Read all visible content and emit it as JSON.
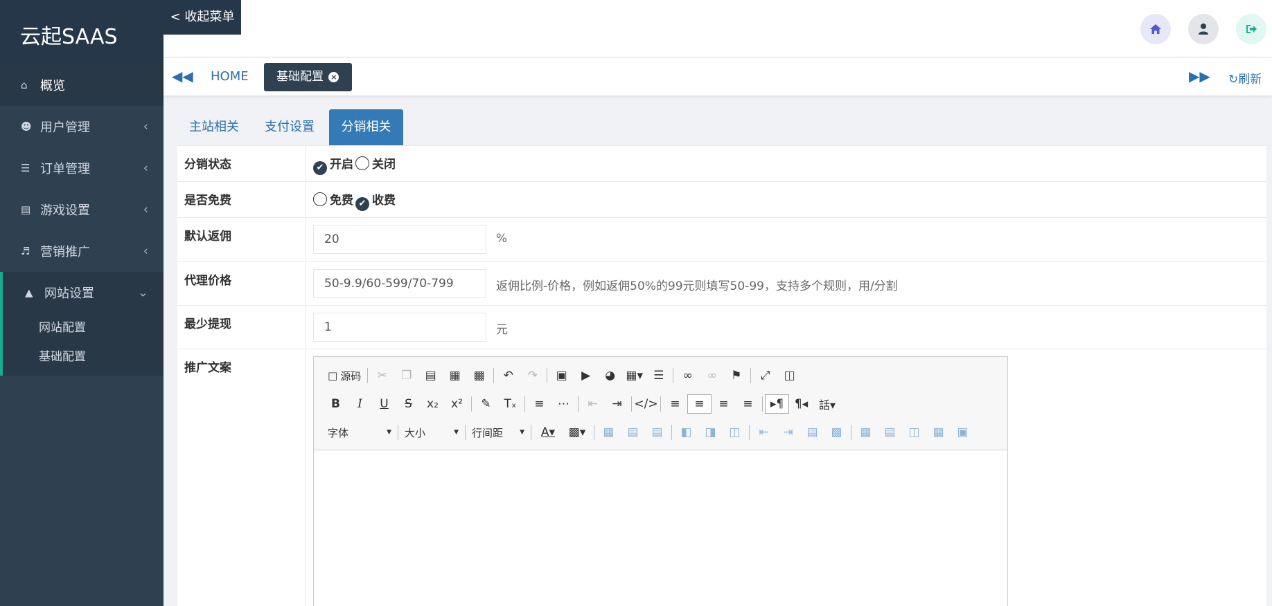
{
  "brand": "云起SAAS",
  "sidebar": {
    "items": [
      {
        "label": "概览"
      },
      {
        "label": "用户管理"
      },
      {
        "label": "订单管理"
      },
      {
        "label": "游戏设置"
      },
      {
        "label": "营销推广"
      },
      {
        "label": "网站设置"
      }
    ],
    "sub_items": [
      {
        "label": "网站配置"
      },
      {
        "label": "基础配置"
      }
    ]
  },
  "topbar": {
    "collapse_label": "< 收起菜单"
  },
  "tabbar": {
    "home_label": "HOME",
    "active_tab": "基础配置",
    "refresh_label": "刷新"
  },
  "subtabs": [
    "主站相关",
    "支付设置",
    "分销相关"
  ],
  "form": {
    "status": {
      "label": "分销状态",
      "on": "开启",
      "off": "关闭",
      "selected": "开启"
    },
    "free": {
      "label": "是否免费",
      "free": "免费",
      "paid": "收费",
      "selected": "收费"
    },
    "rebate": {
      "label": "默认返佣",
      "value": "20",
      "unit": "%"
    },
    "agent_price": {
      "label": "代理价格",
      "value": "50-9.9/60-599/70-799",
      "hint": "返佣比例-价格，例如返佣50%的99元则填写50-99，支持多个规则，用/分割"
    },
    "min_withdraw": {
      "label": "最少提现",
      "value": "1",
      "unit": "元"
    },
    "promo_text": {
      "label": "推广文案"
    }
  },
  "editor": {
    "source_label": "源码",
    "font_label": "字体",
    "size_label": "大小",
    "lineheight_label": "行间距"
  },
  "colors": {
    "sidebar": "#2f4050",
    "accent": "#337ab7",
    "active_border": "#19aa8d"
  }
}
